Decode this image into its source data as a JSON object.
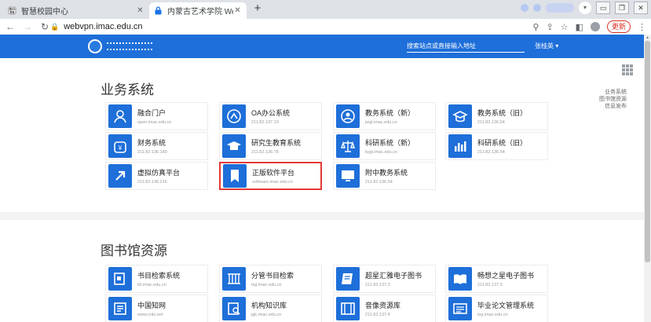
{
  "browser": {
    "tabs": [
      {
        "title": "智慧校园中心",
        "active": false
      },
      {
        "title": "内蒙古艺术学院 WebVPN",
        "active": true
      }
    ],
    "new_tab": "+",
    "address": "webvpn.imac.edu.cn",
    "update_label": "更新",
    "colors": {
      "tab_strip": "#dee1e6",
      "update_red": "#d93025"
    }
  },
  "header": {
    "search_placeholder": "搜索站点或直接输入地址",
    "user": "张桂英 ▾",
    "color": "#1e6fd9"
  },
  "side_links": [
    "业务系统",
    "图书馆资源",
    "信息发布"
  ],
  "sections": [
    {
      "title": "业务系统",
      "items": [
        {
          "name": "融合门户",
          "sub": "open.imac.edu.cn",
          "icon": "portal-icon"
        },
        {
          "name": "OA办公系统",
          "sub": "211.82.137.19",
          "icon": "oa-icon"
        },
        {
          "name": "教务系统（新）",
          "sub": "jwgl.imac.edu.cn",
          "icon": "teaching-new-icon"
        },
        {
          "name": "教务系统（旧）",
          "sub": "211.82.136.54",
          "icon": "teaching-old-icon"
        },
        {
          "name": "财务系统",
          "sub": "211.82.136.180",
          "icon": "finance-icon"
        },
        {
          "name": "研究生教育系统",
          "sub": "211.82.136.78",
          "icon": "graduate-cap-icon"
        },
        {
          "name": "科研系统（新）",
          "sub": "kygl.imac.edu.cn",
          "icon": "research-new-icon"
        },
        {
          "name": "科研系统（旧）",
          "sub": "211.82.136.54",
          "icon": "research-old-icon"
        },
        {
          "name": "虚拟仿真平台",
          "sub": "211.82.136.216",
          "icon": "virtual-sim-icon"
        },
        {
          "name": "正版软件平台",
          "sub": "software.imac.edu.cn",
          "icon": "bookmark-icon",
          "highlighted": true
        },
        {
          "name": "附中教务系统",
          "sub": "211.82.136.54",
          "icon": "monitor-icon"
        }
      ]
    },
    {
      "title": "图书馆资源",
      "items": [
        {
          "name": "书目检索系统",
          "sub": "lib.imac.edu.cn",
          "icon": "catalog-search-icon"
        },
        {
          "name": "分管书目检索",
          "sub": "tsg.imac.edu.cn",
          "icon": "branch-catalog-icon"
        },
        {
          "name": "超星汇雅电子图书",
          "sub": "211.82.137.3",
          "icon": "ebook-icon"
        },
        {
          "name": "畅想之星电子图书",
          "sub": "211.82.137.3",
          "icon": "open-book-icon"
        },
        {
          "name": "中国知网",
          "sub": "www.cnki.net",
          "icon": "cnki-icon"
        },
        {
          "name": "机构知识库",
          "sub": "jgk.imac.edu.cn",
          "icon": "knowledge-base-icon"
        },
        {
          "name": "音像资源库",
          "sub": "211.82.137.4",
          "icon": "video-icon"
        },
        {
          "name": "毕业论文管理系统",
          "sub": "tsg.imac.edu.cn",
          "icon": "thesis-icon"
        }
      ]
    }
  ]
}
